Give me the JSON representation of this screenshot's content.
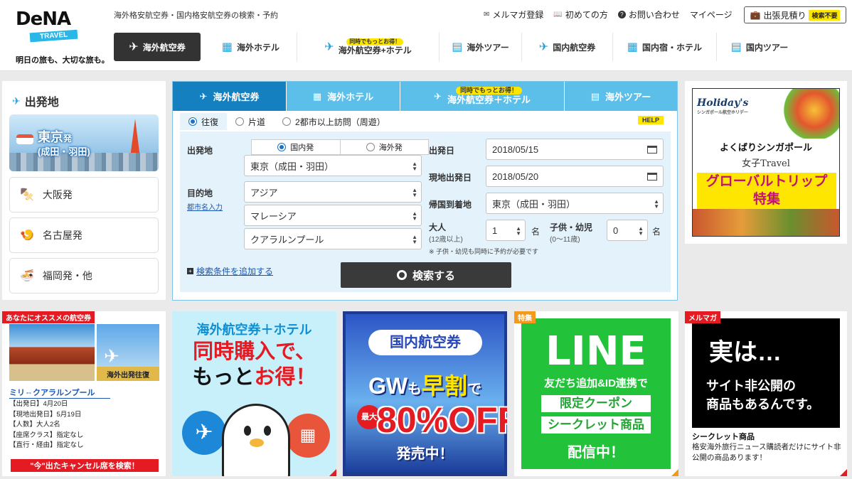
{
  "header": {
    "logo_text": "DeNA",
    "logo_sub": "TRAVEL",
    "tagline": "明日の旅も、大切な旅も。",
    "description": "海外格安航空券・国内格安航空券の検索・予約",
    "links": [
      {
        "label": "メルマガ登録",
        "icon": "mail-icon"
      },
      {
        "label": "初めての方",
        "icon": "book-icon"
      },
      {
        "label": "お問い合わせ",
        "icon": "question-icon"
      },
      {
        "label": "マイページ",
        "icon": ""
      }
    ],
    "business_trip": {
      "label": "出張見積り",
      "badge": "検索不要"
    }
  },
  "global_nav": [
    {
      "label": "海外航空券",
      "sub": ""
    },
    {
      "label": "海外ホテル",
      "sub": ""
    },
    {
      "label": "海外航空券+ホテル",
      "sub": "同時でもっとお得！"
    },
    {
      "label": "海外ツアー",
      "sub": ""
    },
    {
      "label": "国内航空券",
      "sub": ""
    },
    {
      "label": "国内宿・ホテル",
      "sub": ""
    },
    {
      "label": "国内ツアー",
      "sub": ""
    }
  ],
  "departure": {
    "title": "出発地",
    "tokyo_line1": "東京",
    "tokyo_suffix": "発",
    "tokyo_line2": "(成田・羽田)",
    "options": [
      "大阪発",
      "名古屋発",
      "福岡発・他"
    ]
  },
  "search": {
    "tabs": [
      {
        "label": "海外航空券",
        "sub": ""
      },
      {
        "label": "海外ホテル",
        "sub": ""
      },
      {
        "label": "海外航空券＋ホテル",
        "sub": "同時でもっとお得！"
      },
      {
        "label": "海外ツアー",
        "sub": ""
      }
    ],
    "trip_types": [
      "往復",
      "片道",
      "2都市以上訪問（周遊）"
    ],
    "help": "HELP",
    "origin_label": "出発地",
    "origin_toggle": [
      "国内発",
      "海外発"
    ],
    "origin_value": "東京（成田・羽田）",
    "dest_label": "目的地",
    "city_input_link": "都市名入力",
    "dest_region": "アジア",
    "dest_country": "マレーシア",
    "dest_city": "クアラルンプール",
    "depart_date_label": "出発日",
    "depart_date": "2018/05/15",
    "local_depart_label": "現地出発日",
    "local_depart_date": "2018/05/20",
    "return_label": "帰国到着地",
    "return_value": "東京（成田・羽田）",
    "adult_label": "大人",
    "adult_sub": "(12歳以上)",
    "adult_value": "1",
    "child_label": "子供・幼児",
    "child_sub": "(0〜11歳)",
    "child_value": "0",
    "unit": "名",
    "note": "※ 子供・幼児も同時に予約が必要です",
    "add_condition": "検索条件を追加する",
    "search_button": "検索する"
  },
  "right_ad": {
    "logo": "Holiday's",
    "logo_sub": "シンガポール航空ホリデー",
    "line1": "よくばりシンガポール",
    "line2": "女子Travel",
    "line3": "グローバルトリップ",
    "line4": "特集"
  },
  "cards": {
    "recommend": {
      "label": "あなたにオススメの航空券",
      "image_caption": "海外出発往復",
      "route": "ミリ⇔クアラルンプール",
      "info": [
        "【出発日】4月20日",
        "【現地出発日】5月19日",
        "【人数】大人2名",
        "【座席クラス】指定なし",
        "【直行・経由】指定なし"
      ],
      "button": "\"今\"出たキャンセル席を検索！"
    },
    "air_hotel": {
      "line1": "海外航空券＋ホテル",
      "line2": "同時購入で、",
      "line3a": "もっと",
      "line3b": "お得！"
    },
    "domestic": {
      "line1": "国内航空券",
      "line2a": "GW",
      "line2b": "も",
      "line2c": "早割",
      "line2d": "で",
      "max": "最大",
      "percent": "80%OFF",
      "line4": "発売中！"
    },
    "line": {
      "label": "特集",
      "title": "LINE",
      "line2": "友だち追加&ID連携で",
      "band1": "限定クーポン",
      "band2": "シークレット商品",
      "line5": "配信中！"
    },
    "mailmag": {
      "label": "メルマガ",
      "line1": "実は…",
      "line2": "サイト非公開の",
      "line3": "商品もあるんです。",
      "heading": "シークレット商品",
      "text": "格安海外旅行ニュース購読者だけにサイト非公開の商品あります！"
    }
  }
}
